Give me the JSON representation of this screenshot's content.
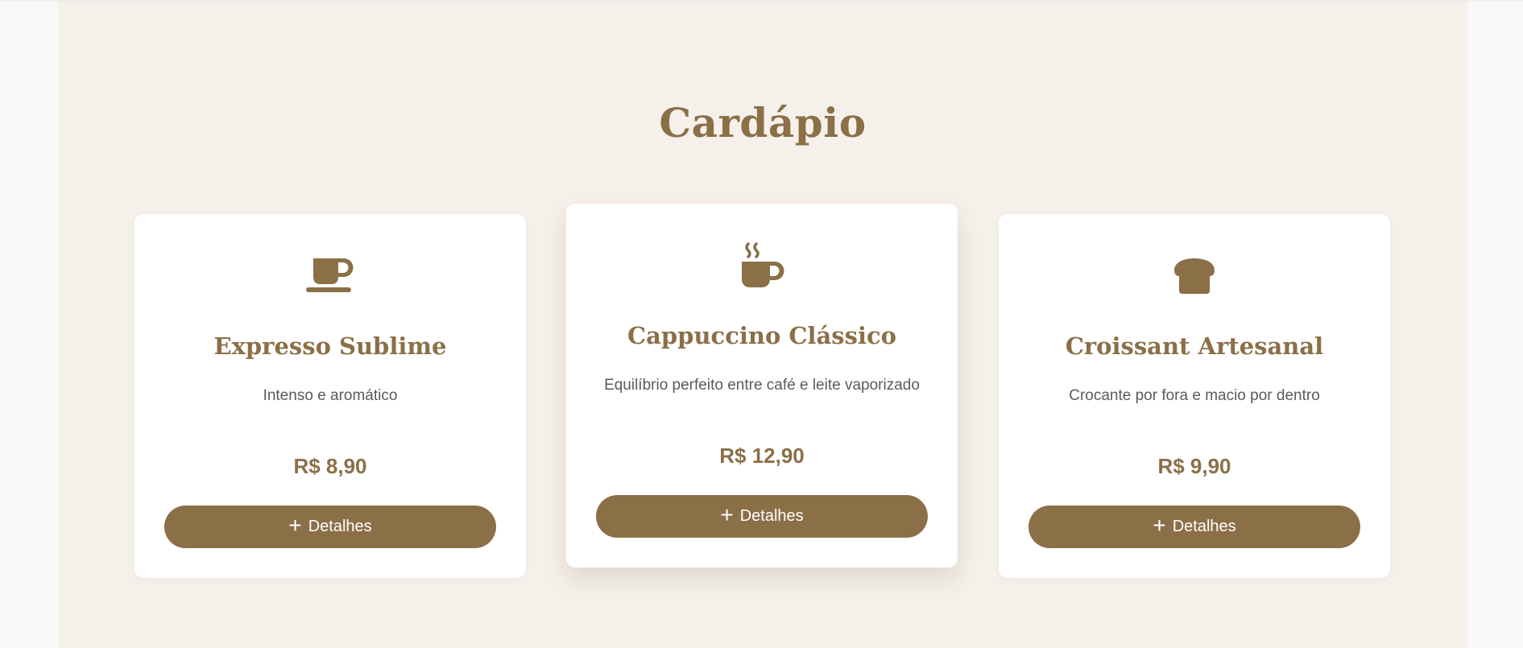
{
  "menu": {
    "title": "Cardápio",
    "items": [
      {
        "icon": "mug-saucer-icon",
        "name": "Expresso Sublime",
        "description": "Intenso e aromático",
        "price": "R$ 8,90",
        "button_label": "Detalhes"
      },
      {
        "icon": "mug-hot-icon",
        "name": "Cappuccino Clássico",
        "description": "Equilíbrio perfeito entre café e leite vaporizado",
        "price": "R$ 12,90",
        "button_label": "Detalhes"
      },
      {
        "icon": "bread-slice-icon",
        "name": "Croissant Artesanal",
        "description": "Crocante por fora e macio por dentro",
        "price": "R$ 9,90",
        "button_label": "Detalhes"
      }
    ],
    "button_icon": "plus-icon"
  },
  "colors": {
    "accent": "#8b6f47",
    "section_background": "#f5f0ea",
    "page_background": "#f9f9f9",
    "card_background": "#ffffff",
    "body_text": "#5a5a5a"
  }
}
